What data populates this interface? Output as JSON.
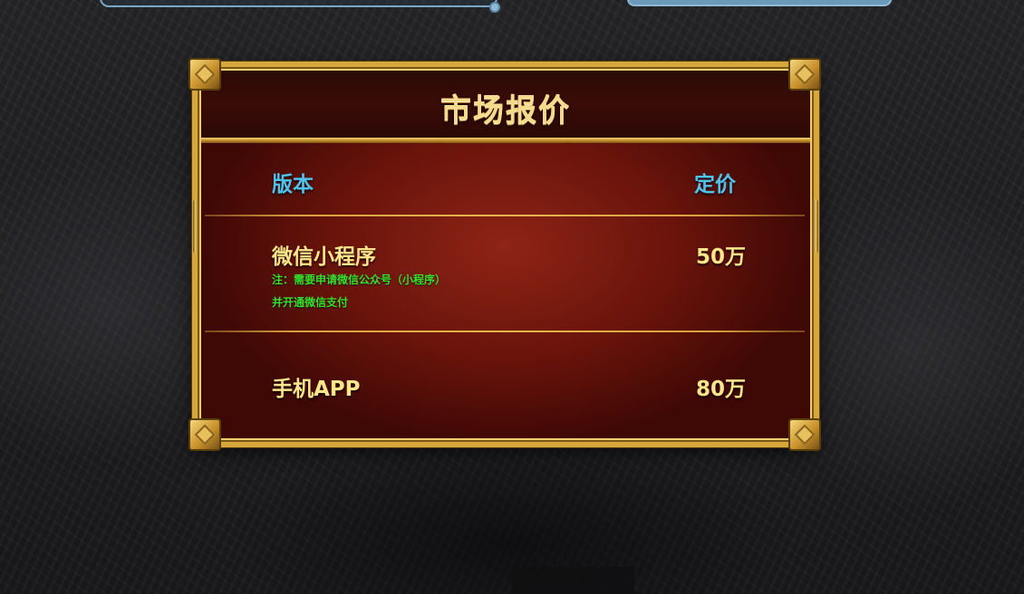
{
  "panel": {
    "title": "市场报价"
  },
  "table": {
    "headers": {
      "version": "版本",
      "price": "定价"
    },
    "rows": [
      {
        "name": "微信小程序",
        "price": "50万",
        "notes": [
          "注：需要申请微信公众号（小程序）",
          "并开通微信支付"
        ]
      },
      {
        "name": "手机APP",
        "price": "80万"
      }
    ]
  },
  "colors": {
    "gold_frame": "#d7a73c",
    "panel_red": "#6a140b",
    "header_blue": "#4ec3ee",
    "item_yellow": "#fbe58a",
    "note_green": "#37e02c",
    "top_bar_blue": "#7aa7c4"
  }
}
